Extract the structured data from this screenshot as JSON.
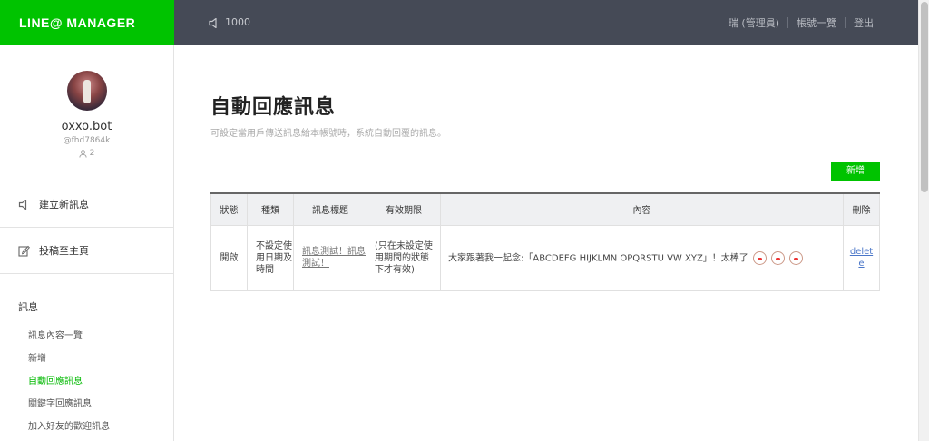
{
  "header": {
    "logo": "LINE@ MANAGER",
    "count": "1000",
    "nav": [
      "瑞 (管理員)",
      "帳號一覽",
      "登出"
    ]
  },
  "sidebar": {
    "bot_name": "oxxo.bot",
    "bot_id": "@fhd7864k",
    "friend_count": "2",
    "actions": [
      "建立新訊息",
      "投稿至主頁"
    ],
    "menu_title": "訊息",
    "menu_items": [
      "訊息內容一覽",
      "新增",
      "自動回應訊息",
      "關鍵字回應訊息",
      "加入好友的歡迎訊息"
    ],
    "active_item": "自動回應訊息"
  },
  "main": {
    "title": "自動回應訊息",
    "subtitle": "可設定當用戶傳送訊息給本帳號時，系統自動回覆的訊息。",
    "add_button": "新增",
    "table": {
      "headers": [
        "狀態",
        "種類",
        "訊息標題",
        "有效期限",
        "內容",
        "刪除"
      ],
      "rows": [
        {
          "status": "開啟",
          "type": "不設定使用日期及時間",
          "title": "訊息測試！訊息測試！",
          "valid": "(只在未設定使用期間的狀態下才有效)",
          "content": "大家跟著我一起念:「ABCDEFG HIJKLMN OPQRSTU VW XYZ」！太棒了",
          "delete": "delete"
        }
      ]
    }
  },
  "colors": {
    "brand_green": "#00c300",
    "topbar": "#454a56"
  }
}
